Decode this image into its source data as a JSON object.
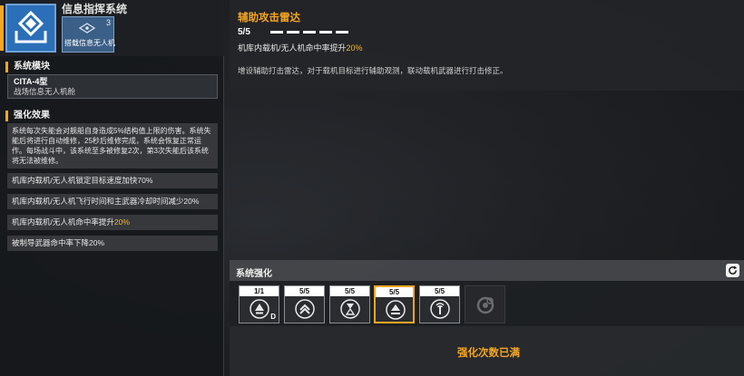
{
  "system": {
    "title": "信息指挥系统",
    "sub_card": {
      "count": "3",
      "label": "搭载信息无人机"
    }
  },
  "module": {
    "section_title": "系统模块",
    "name": "CITA-4型",
    "desc": "战场信息无人机舱"
  },
  "effects": {
    "section_title": "强化效果",
    "paragraph": "系统每次失能会对舰船自身造成5%结构值上限的伤害。系统失能后将进行自动维修，25秒后维修完成，系统会恢复正常运作。每场战斗中，该系统至多被修复2次，第3次失能后该系统将无法被维修。",
    "rows": [
      {
        "text": "机库内载机/无人机锁定目标速度加快70%"
      },
      {
        "text": "机库内载机/无人机飞行时间和主武器冷却时间减少20%"
      },
      {
        "text_prefix": "机库内载机/无人机命中率提升",
        "highlight": "20%"
      },
      {
        "text": "被制导武器命中率下降20%"
      }
    ]
  },
  "detail": {
    "title": "辅助攻击雷达",
    "level": "5/5",
    "level_filled": 5,
    "level_total": 5,
    "bonus_prefix": "机库内载机/无人机命中率提升",
    "bonus_value": "20%",
    "description": "增设辅助打击雷达，对于载机目标进行辅助观测，联动载机武器进行打击修正。"
  },
  "enhance": {
    "title": "系统强化",
    "refresh_icon": "refresh-icon",
    "slots": [
      {
        "count": "1/1",
        "icon": "emblem-d-icon",
        "mark": "D",
        "state": "normal"
      },
      {
        "count": "5/5",
        "icon": "chevron-up-icon",
        "state": "normal"
      },
      {
        "count": "5/5",
        "icon": "hourglass-icon",
        "state": "normal"
      },
      {
        "count": "5/5",
        "icon": "radar-up-icon",
        "state": "active"
      },
      {
        "count": "5/5",
        "icon": "signal-tower-icon",
        "state": "normal"
      },
      {
        "count": "",
        "icon": "locked-gear-icon",
        "state": "locked"
      }
    ],
    "max_text": "强化次数已满"
  },
  "colors": {
    "accent": "#f5a623",
    "highlight": "#f5b52a",
    "system_icon_bg": "#2b6fb8"
  }
}
